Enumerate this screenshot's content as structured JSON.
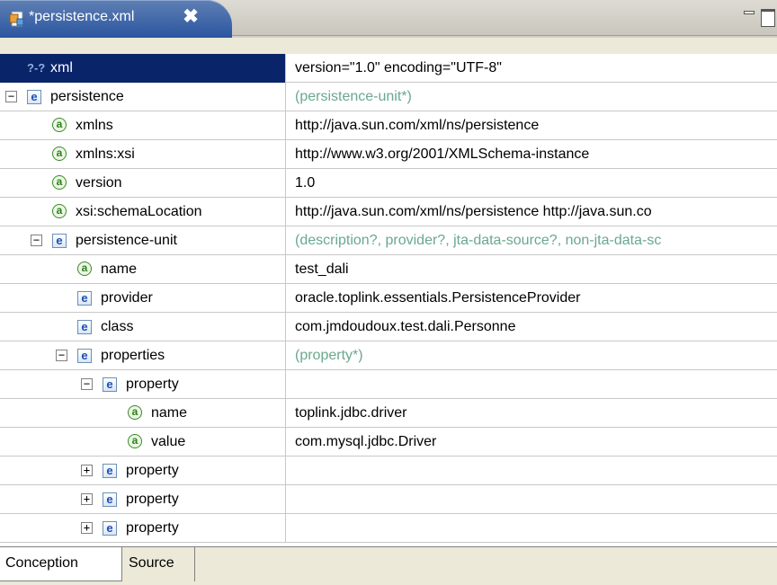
{
  "tab": {
    "title": "*persistence.xml",
    "close": "✖"
  },
  "rows": [
    {
      "indent": 0,
      "toggle": null,
      "icon": "xml",
      "icon_text": "?-?",
      "name": "xml",
      "value": "version=\"1.0\" encoding=\"UTF-8\"",
      "hint": false,
      "selected": true
    },
    {
      "indent": 0,
      "toggle": "−",
      "icon": "e",
      "icon_text": "e",
      "name": "persistence",
      "value": "(persistence-unit*)",
      "hint": true
    },
    {
      "indent": 1,
      "toggle": null,
      "icon": "a",
      "icon_text": "a",
      "name": "xmlns",
      "value": "http://java.sun.com/xml/ns/persistence",
      "hint": false
    },
    {
      "indent": 1,
      "toggle": null,
      "icon": "a",
      "icon_text": "a",
      "name": "xmlns:xsi",
      "value": "http://www.w3.org/2001/XMLSchema-instance",
      "hint": false
    },
    {
      "indent": 1,
      "toggle": null,
      "icon": "a",
      "icon_text": "a",
      "name": "version",
      "value": "1.0",
      "hint": false
    },
    {
      "indent": 1,
      "toggle": null,
      "icon": "a",
      "icon_text": "a",
      "name": "xsi:schemaLocation",
      "value": "http://java.sun.com/xml/ns/persistence http://java.sun.co",
      "hint": false
    },
    {
      "indent": 1,
      "toggle": "−",
      "icon": "e",
      "icon_text": "e",
      "name": "persistence-unit",
      "value": "(description?, provider?, jta-data-source?, non-jta-data-sc",
      "hint": true
    },
    {
      "indent": 2,
      "toggle": null,
      "icon": "a",
      "icon_text": "a",
      "name": "name",
      "value": "test_dali",
      "hint": false
    },
    {
      "indent": 2,
      "toggle": null,
      "icon": "e",
      "icon_text": "e",
      "name": "provider",
      "value": "oracle.toplink.essentials.PersistenceProvider",
      "hint": false
    },
    {
      "indent": 2,
      "toggle": null,
      "icon": "e",
      "icon_text": "e",
      "name": "class",
      "value": "com.jmdoudoux.test.dali.Personne",
      "hint": false
    },
    {
      "indent": 2,
      "toggle": "−",
      "icon": "e",
      "icon_text": "e",
      "name": "properties",
      "value": "(property*)",
      "hint": true
    },
    {
      "indent": 3,
      "toggle": "−",
      "icon": "e",
      "icon_text": "e",
      "name": "property",
      "value": "",
      "hint": false
    },
    {
      "indent": 4,
      "toggle": null,
      "icon": "a",
      "icon_text": "a",
      "name": "name",
      "value": "toplink.jdbc.driver",
      "hint": false
    },
    {
      "indent": 4,
      "toggle": null,
      "icon": "a",
      "icon_text": "a",
      "name": "value",
      "value": "com.mysql.jdbc.Driver",
      "hint": false
    },
    {
      "indent": 3,
      "toggle": "+",
      "icon": "e",
      "icon_text": "e",
      "name": "property",
      "value": "",
      "hint": false
    },
    {
      "indent": 3,
      "toggle": "+",
      "icon": "e",
      "icon_text": "e",
      "name": "property",
      "value": "",
      "hint": false
    },
    {
      "indent": 3,
      "toggle": "+",
      "icon": "e",
      "icon_text": "e",
      "name": "property",
      "value": "",
      "hint": false
    }
  ],
  "bottom_tabs": [
    {
      "label": "Conception",
      "active": true
    },
    {
      "label": "Source",
      "active": false
    }
  ]
}
